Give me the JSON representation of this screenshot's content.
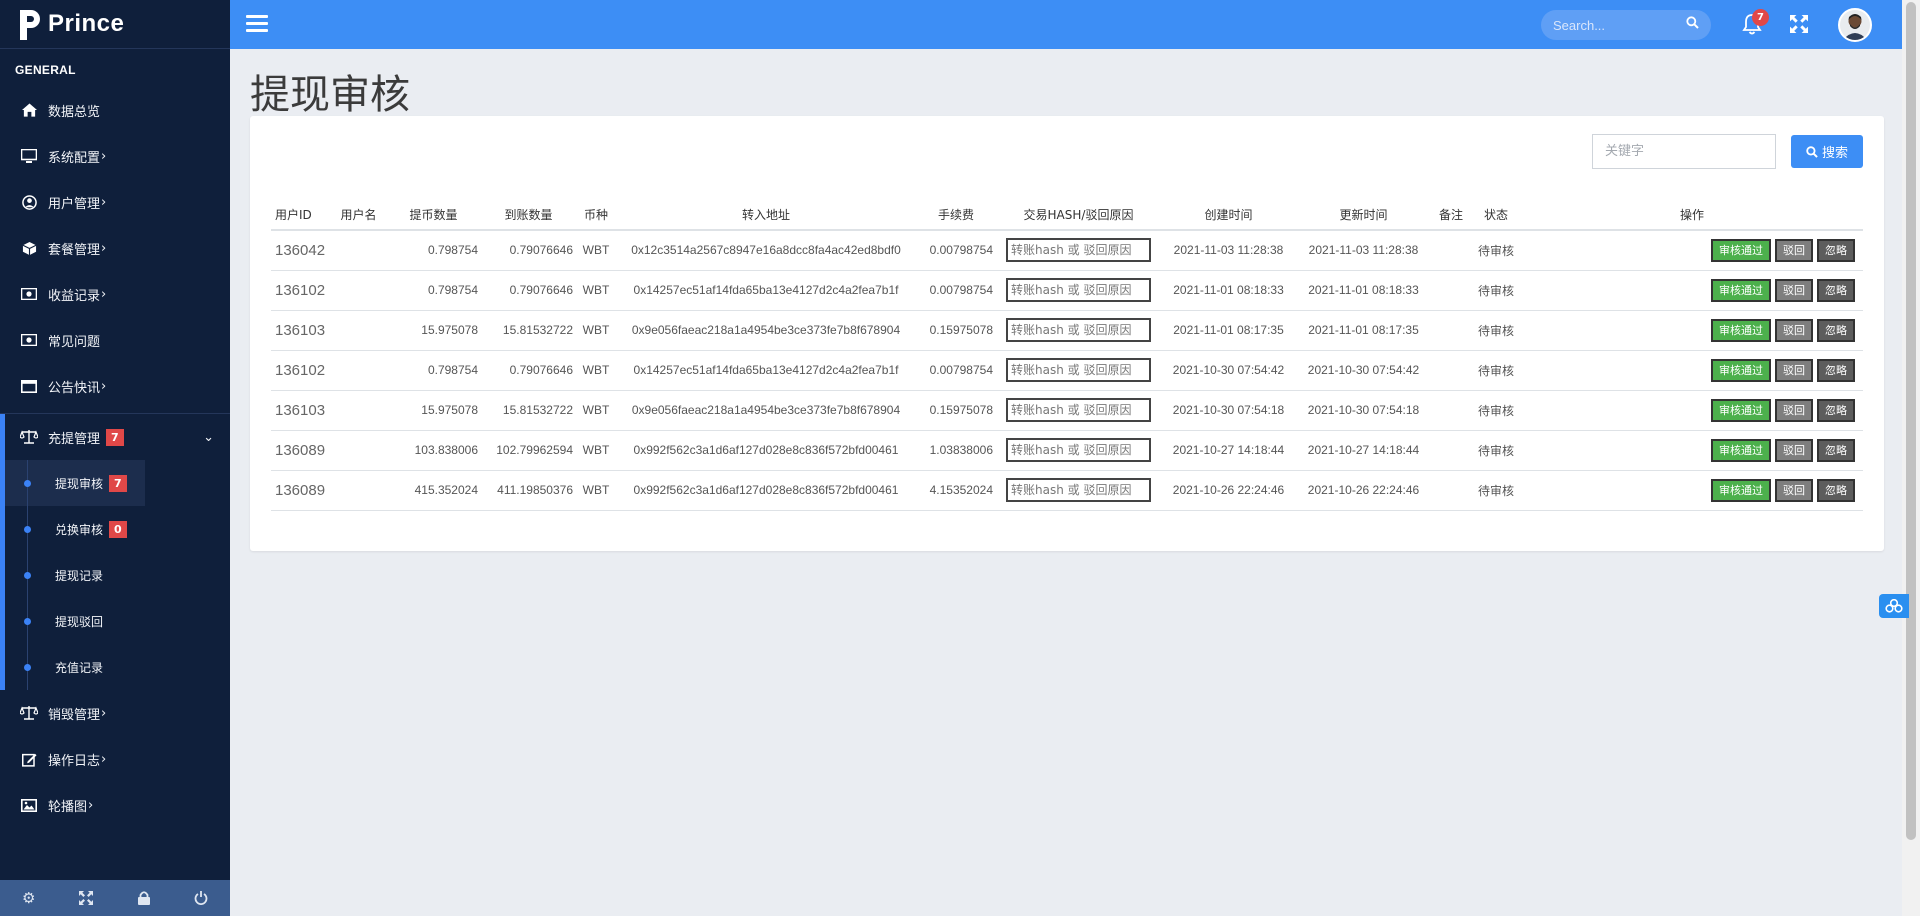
{
  "sidebar": {
    "brand": "Prince",
    "section": "GENERAL",
    "items": [
      {
        "label": "数据总览",
        "icon": "home-icon"
      },
      {
        "label": "系统配置",
        "icon": "monitor-icon"
      },
      {
        "label": "用户管理",
        "icon": "user-circle-icon"
      },
      {
        "label": "套餐管理",
        "icon": "cube-icon"
      },
      {
        "label": "收益记录",
        "icon": "money-icon"
      },
      {
        "label": "常见问题",
        "icon": "money-icon"
      },
      {
        "label": "公告快讯",
        "icon": "window-icon"
      }
    ],
    "open_group": {
      "label": "充提管理",
      "badge": "7",
      "children": [
        {
          "label": "提现审核",
          "badge": "7"
        },
        {
          "label": "兑换审核",
          "badge": "0"
        },
        {
          "label": "提现记录"
        },
        {
          "label": "提现驳回"
        },
        {
          "label": "充值记录"
        }
      ]
    },
    "items_after": [
      {
        "label": "销毁管理",
        "icon": "balance-scale-icon"
      },
      {
        "label": "操作日志",
        "icon": "edit-icon"
      },
      {
        "label": "轮播图",
        "icon": "image-icon"
      }
    ]
  },
  "topbar": {
    "search_placeholder": "Search...",
    "notification_count": "7"
  },
  "page": {
    "title": "提现审核",
    "keyword_placeholder": "关键字",
    "search_label": "搜索"
  },
  "table": {
    "headers": [
      "用户ID",
      "用户名",
      "提币数量",
      "到账数量",
      "币种",
      "转入地址",
      "手续费",
      "交易HASH/驳回原因",
      "创建时间",
      "更新时间",
      "备注",
      "状态",
      "操作"
    ],
    "hash_placeholder": "转账hash 或 驳回原因",
    "actions": {
      "approve": "审核通过",
      "reject": "驳回",
      "ignore": "忽略"
    },
    "rows": [
      {
        "uid": "136042",
        "username": "",
        "amount": "0.798754",
        "received": "0.79076646",
        "coin": "WBT",
        "address": "0x12c3514a2567c8947e16a8dcc8fa4ac42ed8bdf0",
        "fee": "0.00798754",
        "created": "2021-11-03 11:28:38",
        "updated": "2021-11-03 11:28:38",
        "note": "",
        "status": "待审核"
      },
      {
        "uid": "136102",
        "username": "",
        "amount": "0.798754",
        "received": "0.79076646",
        "coin": "WBT",
        "address": "0x14257ec51af14fda65ba13e4127d2c4a2fea7b1f",
        "fee": "0.00798754",
        "created": "2021-11-01 08:18:33",
        "updated": "2021-11-01 08:18:33",
        "note": "",
        "status": "待审核"
      },
      {
        "uid": "136103",
        "username": "",
        "amount": "15.975078",
        "received": "15.81532722",
        "coin": "WBT",
        "address": "0x9e056faeac218a1a4954be3ce373fe7b8f678904",
        "fee": "0.15975078",
        "created": "2021-11-01 08:17:35",
        "updated": "2021-11-01 08:17:35",
        "note": "",
        "status": "待审核"
      },
      {
        "uid": "136102",
        "username": "",
        "amount": "0.798754",
        "received": "0.79076646",
        "coin": "WBT",
        "address": "0x14257ec51af14fda65ba13e4127d2c4a2fea7b1f",
        "fee": "0.00798754",
        "created": "2021-10-30 07:54:42",
        "updated": "2021-10-30 07:54:42",
        "note": "",
        "status": "待审核"
      },
      {
        "uid": "136103",
        "username": "",
        "amount": "15.975078",
        "received": "15.81532722",
        "coin": "WBT",
        "address": "0x9e056faeac218a1a4954be3ce373fe7b8f678904",
        "fee": "0.15975078",
        "created": "2021-10-30 07:54:18",
        "updated": "2021-10-30 07:54:18",
        "note": "",
        "status": "待审核"
      },
      {
        "uid": "136089",
        "username": "",
        "amount": "103.838006",
        "received": "102.79962594",
        "coin": "WBT",
        "address": "0x992f562c3a1d6af127d028e8c836f572bfd00461",
        "fee": "1.03838006",
        "created": "2021-10-27 14:18:44",
        "updated": "2021-10-27 14:18:44",
        "note": "",
        "status": "待审核"
      },
      {
        "uid": "136089",
        "username": "",
        "amount": "415.352024",
        "received": "411.19850376",
        "coin": "WBT",
        "address": "0x992f562c3a1d6af127d028e8c836f572bfd00461",
        "fee": "4.15352024",
        "created": "2021-10-26 22:24:46",
        "updated": "2021-10-26 22:24:46",
        "note": "",
        "status": "待审核"
      }
    ]
  },
  "colors": {
    "sidebar_bg": "#0f1f3b",
    "topbar": "#3d8ef5",
    "approve": "#4cb04c",
    "badge": "#e04848"
  }
}
